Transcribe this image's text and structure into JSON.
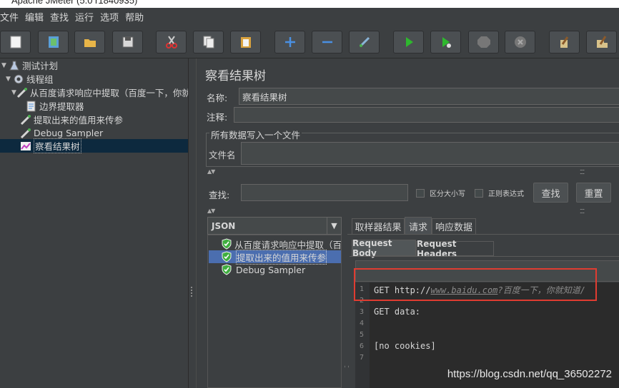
{
  "window": {
    "title": "Apache JMeter (5.0 r1840935)"
  },
  "menu": {
    "items": [
      "文件",
      "编辑",
      "查找",
      "运行",
      "选项",
      "帮助"
    ]
  },
  "toolbar": {
    "buttons": [
      "new-icon",
      "templates-icon",
      "open-icon",
      "save-icon",
      "cut-icon",
      "copy-icon",
      "paste-icon",
      "expand-icon",
      "collapse-icon",
      "toggle-icon",
      "start-icon",
      "start-no-pause-icon",
      "stop-icon",
      "shutdown-icon",
      "clear-icon",
      "clear-all-icon"
    ]
  },
  "tree": {
    "items": [
      {
        "label": "测试计划",
        "icon": "flask-icon",
        "expanded": true
      },
      {
        "label": "线程组",
        "icon": "gear-icon",
        "expanded": true
      },
      {
        "label": "从百度请求响应中提取（百度一下，你就",
        "icon": "pipette-icon",
        "expanded": true
      },
      {
        "label": "边界提取器",
        "icon": "document-icon"
      },
      {
        "label": "提取出来的值用来传参",
        "icon": "pipette-icon"
      },
      {
        "label": "Debug Sampler",
        "icon": "pipette-icon"
      },
      {
        "label": "察看结果树",
        "icon": "chart-icon",
        "selected": true
      }
    ]
  },
  "panel": {
    "title": "察看结果树",
    "name_label": "名称:",
    "name_value": "察看结果树",
    "comment_label": "注释:",
    "comment_value": "",
    "file_group_title": "所有数据写入一个文件",
    "filename_label": "文件名",
    "filename_value": "",
    "search_label": "查找:",
    "search_value": "",
    "case_sensitive_label": "区分大小写",
    "regex_label": "正则表达式",
    "search_button": "查找",
    "reset_button": "重置",
    "renderer_value": "JSON"
  },
  "results": {
    "items": [
      {
        "label": "从百度请求响应中提取（百度",
        "status": "success"
      },
      {
        "label": "提取出来的值用来传参",
        "status": "success",
        "selected": true
      },
      {
        "label": "Debug Sampler",
        "status": "success"
      }
    ]
  },
  "tabs": {
    "items": [
      "取样器结果",
      "请求",
      "响应数据"
    ],
    "active": 1
  },
  "subtabs": {
    "items": [
      "Request Body",
      "Request Headers"
    ],
    "active": 0
  },
  "editor": {
    "lines": [
      {
        "n": "1",
        "prefix": "GET http://",
        "url": "www.baidu.com",
        "query": "?百度一下，你就知道/"
      },
      {
        "n": "2",
        "text": ""
      },
      {
        "n": "3",
        "text": "GET data:"
      },
      {
        "n": "4",
        "text": ""
      },
      {
        "n": "5",
        "text": ""
      },
      {
        "n": "6",
        "text": "[no cookies]"
      },
      {
        "n": "7",
        "text": ""
      }
    ]
  },
  "colors": {
    "background": "#3c3f41",
    "selection": "#4b6eaf",
    "highlight_box": "#e03c31",
    "success": "#3fae3f"
  },
  "watermark": "https://blog.csdn.net/qq_36502272"
}
